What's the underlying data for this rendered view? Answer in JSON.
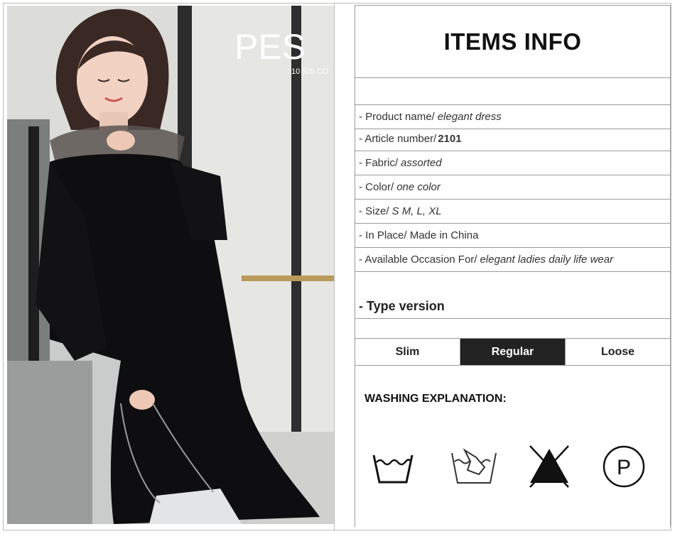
{
  "photo": {
    "sign_text": "PES",
    "sign_subtext": "10 S/S CO"
  },
  "title": "ITEMS INFO",
  "info_rows": [
    {
      "label": "- Product name/",
      "value": "elegant dress"
    },
    {
      "label": "- Article number/",
      "value": "2101"
    },
    {
      "label": "- Fabric/",
      "value": "assorted"
    },
    {
      "label": "- Color/",
      "value": "one color"
    },
    {
      "label": "- Size/",
      "value": "S M, L, XL"
    },
    {
      "label": "- In Place/ Made in China",
      "value": ""
    },
    {
      "label": "- Available Occasion For/",
      "value": "elegant ladies daily life wear"
    }
  ],
  "type_version": "- Type version",
  "fits": [
    {
      "label": "Slim",
      "selected": false
    },
    {
      "label": "Regular",
      "selected": true
    },
    {
      "label": "Loose",
      "selected": false
    }
  ],
  "washing_title": "WASHING EXPLANATION:",
  "care_icons": [
    "wash-tub-icon",
    "hand-wash-icon",
    "no-bleach-icon",
    "dry-clean-p-icon"
  ]
}
